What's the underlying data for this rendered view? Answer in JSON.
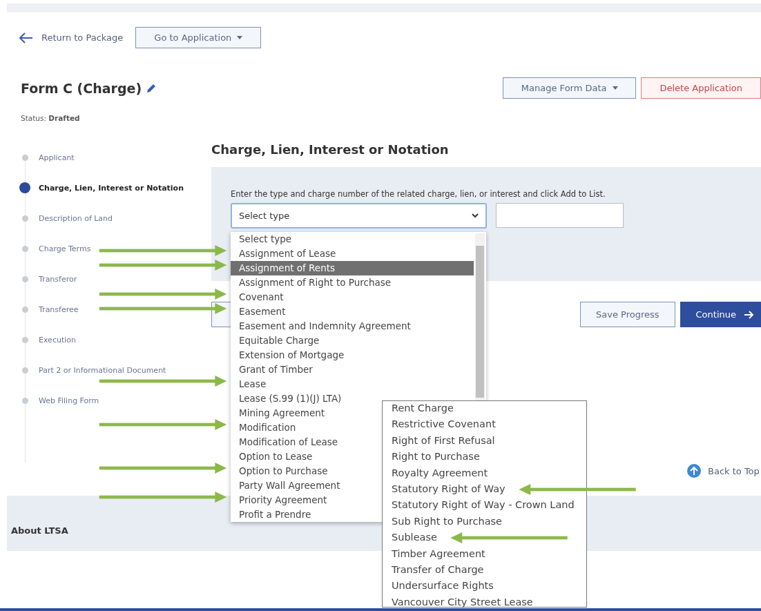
{
  "top_nav": {
    "back_link": "Return to Package",
    "go_to_button": "Go to Application"
  },
  "header": {
    "title": "Form C (Charge)",
    "status_label": "Status:",
    "status_value": "Drafted",
    "buttons": [
      {
        "label": "Manage Form Data",
        "kind": "dropdown"
      },
      {
        "label": "Delete Application",
        "kind": "danger"
      }
    ]
  },
  "steps": [
    {
      "label": "Applicant",
      "selected": false
    },
    {
      "label": "Charge, Lien, Interest or Notation",
      "selected": true
    },
    {
      "label": "Description of Land",
      "selected": false
    },
    {
      "label": "Charge Terms",
      "selected": false
    },
    {
      "label": "Transferor",
      "selected": false
    },
    {
      "label": "Transferee",
      "selected": false
    },
    {
      "label": "Execution",
      "selected": false
    },
    {
      "label": "Part 2 or Informational Document",
      "selected": false
    },
    {
      "label": "Web Filing Form",
      "selected": false
    }
  ],
  "section": {
    "heading": "Charge, Lien, Interest or Notation",
    "instruction": "Enter the type and charge number of the related charge, lien, or interest and click Add to List.",
    "select_value": "Select type"
  },
  "options": [
    {
      "label": "Select type",
      "selected": false,
      "marked": false
    },
    {
      "label": "Assignment of Lease",
      "selected": false,
      "marked": true
    },
    {
      "label": "Assignment of Rents",
      "selected": true,
      "marked": true
    },
    {
      "label": "Assignment of Right to Purchase",
      "selected": false,
      "marked": false
    },
    {
      "label": "Covenant",
      "selected": false,
      "marked": true
    },
    {
      "label": "Easement",
      "selected": false,
      "marked": true
    },
    {
      "label": "Easement and Indemnity Agreement",
      "selected": false,
      "marked": false
    },
    {
      "label": "Equitable Charge",
      "selected": false,
      "marked": false
    },
    {
      "label": "Extension of Mortgage",
      "selected": false,
      "marked": false
    },
    {
      "label": "Grant of Timber",
      "selected": false,
      "marked": false
    },
    {
      "label": "Lease",
      "selected": false,
      "marked": true
    },
    {
      "label": "Lease (S.99 (1)(J) LTA)",
      "selected": false,
      "marked": false
    },
    {
      "label": "Mining Agreement",
      "selected": false,
      "marked": false
    },
    {
      "label": "Modification",
      "selected": false,
      "marked": true
    },
    {
      "label": "Modification of Lease",
      "selected": false,
      "marked": false
    },
    {
      "label": "Option to Lease",
      "selected": false,
      "marked": false
    },
    {
      "label": "Option to Purchase",
      "selected": false,
      "marked": true
    },
    {
      "label": "Party Wall Agreement",
      "selected": false,
      "marked": false
    },
    {
      "label": "Priority Agreement",
      "selected": false,
      "marked": true
    },
    {
      "label": "Profit a Prendre",
      "selected": false,
      "marked": false
    }
  ],
  "actions": [
    {
      "label": "Save Progress",
      "kind": "secondary"
    },
    {
      "label": "Continue",
      "kind": "primary"
    }
  ],
  "back_to_top": "Back to Top",
  "more_options": [
    {
      "label": "Rent Charge",
      "marked": false
    },
    {
      "label": "Restrictive Covenant",
      "marked": false
    },
    {
      "label": "Right of First Refusal",
      "marked": false
    },
    {
      "label": "Right to Purchase",
      "marked": false
    },
    {
      "label": "Royalty Agreement",
      "marked": false
    },
    {
      "label": "Statutory Right of Way",
      "marked": true
    },
    {
      "label": "Statutory Right of Way - Crown Land",
      "marked": false
    },
    {
      "label": "Sub Right to Purchase",
      "marked": false
    },
    {
      "label": "Sublease",
      "marked": true
    },
    {
      "label": "Timber Agreement",
      "marked": false
    },
    {
      "label": "Transfer of Charge",
      "marked": false
    },
    {
      "label": "Undersurface Rights",
      "marked": false
    },
    {
      "label": "Vancouver City Street Lease",
      "marked": false
    }
  ],
  "footer": {
    "title": "About LTSA"
  }
}
